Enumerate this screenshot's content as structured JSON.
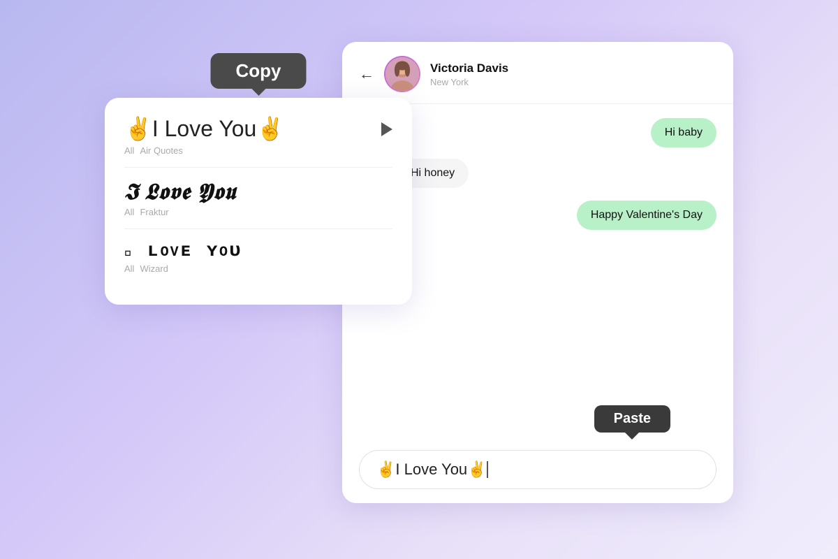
{
  "background": {
    "gradient_start": "#b8b8f0",
    "gradient_end": "#f0ecfc"
  },
  "font_panel": {
    "copy_tooltip": "Copy",
    "items": [
      {
        "text": "✌️I Love You✌️",
        "style_name": "Air Quotes",
        "category": "All",
        "font_class": "air-quotes",
        "has_arrow": true
      },
      {
        "text": "I Love You",
        "style_name": "Fraktur",
        "category": "All",
        "font_class": "fraktur",
        "has_arrow": false
      },
      {
        "text": "ɪ ʟovᴇ ʏoᴜ",
        "style_name": "Wizard",
        "category": "All",
        "font_class": "wizard",
        "has_arrow": false
      }
    ]
  },
  "chat_panel": {
    "contact": {
      "name": "Victoria Davis",
      "location": "New York"
    },
    "messages": [
      {
        "id": 1,
        "text": "Hi baby",
        "side": "right",
        "style": "green"
      },
      {
        "id": 2,
        "text": "Hi honey",
        "side": "left",
        "style": "white"
      },
      {
        "id": 3,
        "text": "Happy Valentine's Day",
        "side": "right",
        "style": "green"
      }
    ],
    "input_value": "✌️I Love You✌️",
    "paste_tooltip": "Paste"
  }
}
